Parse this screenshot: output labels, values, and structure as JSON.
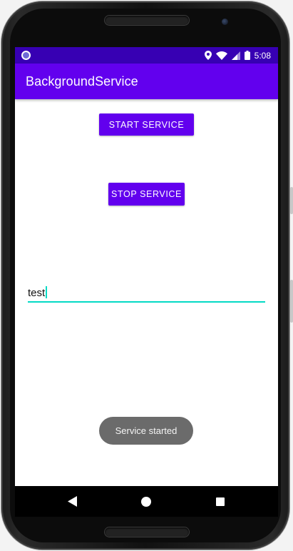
{
  "status_bar": {
    "time": "5:08",
    "icons": [
      "notification-dot-icon",
      "location-icon",
      "wifi-icon",
      "signal-icon",
      "battery-icon"
    ]
  },
  "app_bar": {
    "title": "BackgroundService"
  },
  "buttons": {
    "start_label": "START SERVICE",
    "stop_label": "STOP SERVICE"
  },
  "edit_text": {
    "value": "test"
  },
  "toast": {
    "message": "Service started"
  },
  "navigation": {
    "icons": [
      "back-icon",
      "home-icon",
      "recents-icon"
    ]
  },
  "colors": {
    "status_bar": "#3700b3",
    "primary": "#6200ee",
    "accent": "#03dac5",
    "toast": "#6b6b6b"
  }
}
